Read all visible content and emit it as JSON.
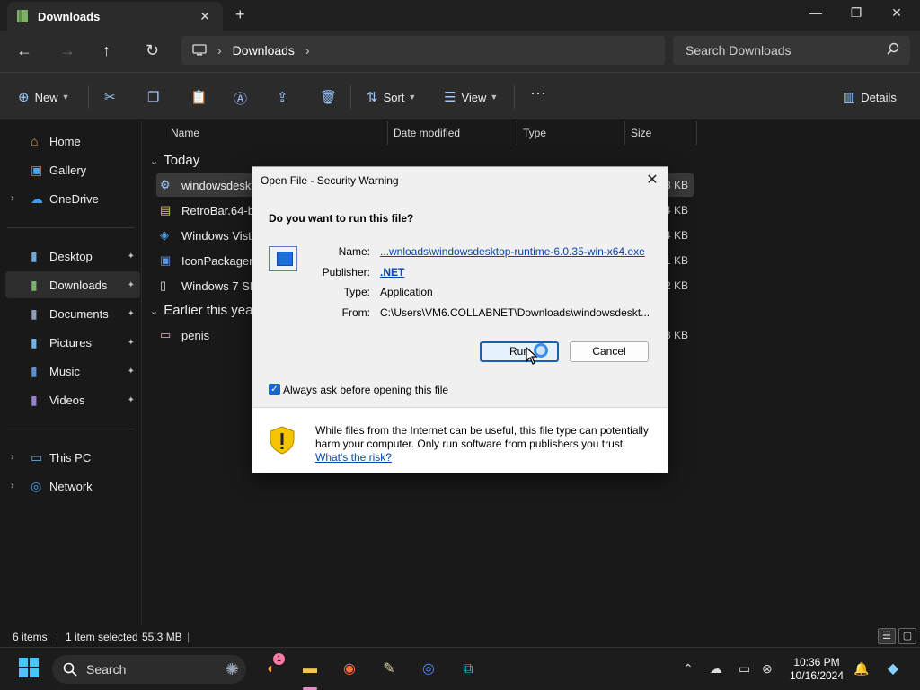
{
  "window": {
    "tab_title": "Downloads",
    "close_tab": "✕",
    "new_tab": "+",
    "minimize": "—",
    "maximize": "❐",
    "close": "✕"
  },
  "address": {
    "back": "←",
    "forward": "→",
    "up": "↑",
    "refresh": "↻",
    "location": "Downloads",
    "separator": "›",
    "search_placeholder": "Search Downloads"
  },
  "commands": {
    "new_label": "New",
    "sort_label": "Sort",
    "view_label": "View",
    "more": "···",
    "details_label": "Details"
  },
  "sidebar": {
    "items": [
      {
        "label": "Home",
        "icon": "⌂"
      },
      {
        "label": "Gallery",
        "icon": "▣"
      },
      {
        "label": "OneDrive",
        "icon": "☁"
      },
      {
        "label": "Desktop",
        "icon": "▮"
      },
      {
        "label": "Downloads",
        "icon": "▮"
      },
      {
        "label": "Documents",
        "icon": "▮"
      },
      {
        "label": "Pictures",
        "icon": "▮"
      },
      {
        "label": "Music",
        "icon": "▮"
      },
      {
        "label": "Videos",
        "icon": "▮"
      },
      {
        "label": "This PC",
        "icon": "▭"
      },
      {
        "label": "Network",
        "icon": "◎"
      }
    ],
    "caret": "›",
    "pin": "📌"
  },
  "filelist": {
    "columns": {
      "name": "Name",
      "date": "Date modified",
      "type": "Type",
      "size": "Size"
    },
    "groups": {
      "today": "Today",
      "earlier": "Earlier this year"
    },
    "chevron": "⌄",
    "rows": [
      {
        "name": "windowsdeskto",
        "size": "8 KB"
      },
      {
        "name": "RetroBar.64-bit",
        "size": "4 KB"
      },
      {
        "name": "Windows Vista",
        "size": "4 KB"
      },
      {
        "name": "IconPackager10",
        "size": "1 KB"
      },
      {
        "name": "Windows 7 SP1",
        "size": "2 KB"
      },
      {
        "name": "penis",
        "size": "3 KB"
      }
    ]
  },
  "status": {
    "items": "6 items",
    "selected": "1 item selected",
    "size": "55.3 MB",
    "sep": "|"
  },
  "taskbar": {
    "search_label": "Search",
    "badge": "1",
    "time": "10:36 PM",
    "date": "10/16/2024"
  },
  "dialog": {
    "title": "Open File - Security Warning",
    "close": "✕",
    "question": "Do you want to run this file?",
    "name_label": "Name:",
    "name_value": "...wnloads\\windowsdesktop-runtime-6.0.35-win-x64.exe",
    "publisher_label": "Publisher:",
    "publisher_value": ".NET",
    "type_label": "Type:",
    "type_value": "Application",
    "from_label": "From:",
    "from_value": "C:\\Users\\VM6.COLLABNET\\Downloads\\windowsdeskt...",
    "run_label": "Run",
    "cancel_label": "Cancel",
    "checkbox_label": "Always ask before opening this file",
    "checkbox_checked": true,
    "warning_text": "While files from the Internet can be useful, this file type can potentially harm your computer. Only run software from publishers you trust.",
    "risk_link": "What's the risk?"
  },
  "colors": {
    "accent": "#1a66c9",
    "link": "#0645ad",
    "shield": "#f5c400"
  }
}
